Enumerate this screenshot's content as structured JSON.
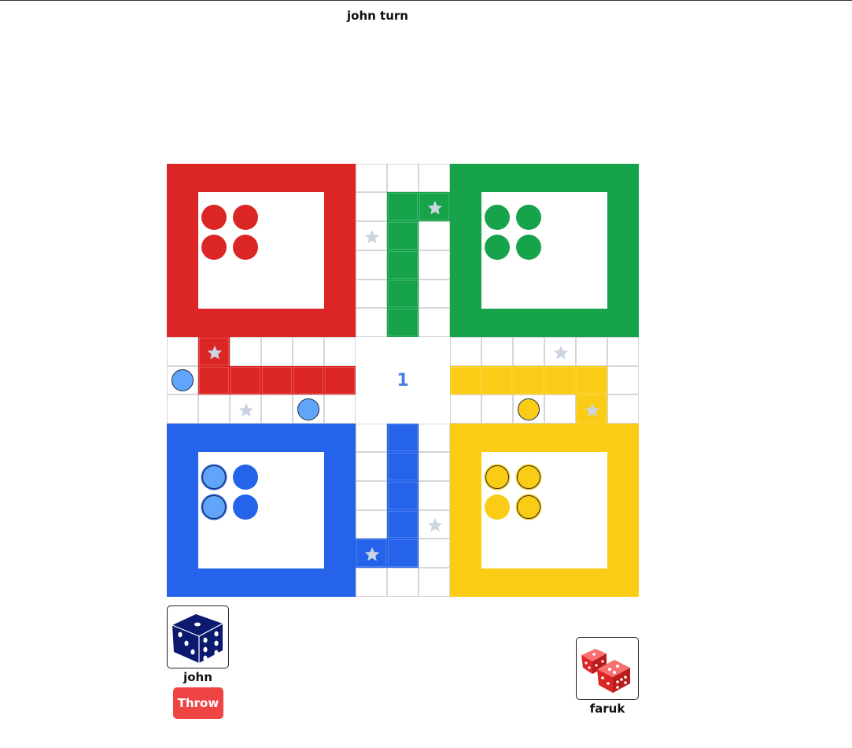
{
  "turn_text": "john turn",
  "center_number": "1",
  "colors": {
    "red": "#dc2626",
    "green": "#16a34a",
    "blue": "#2563eb",
    "yellow": "#facc15",
    "active_token_blue": "#60a5fa",
    "star": "#cbd5e1",
    "grid_line": "#d6d6d6",
    "throw_button": "#ef4444"
  },
  "players": [
    {
      "name": "john",
      "dice_color": "#0b1a6e",
      "icon": "single-dice-icon",
      "active": true
    },
    {
      "name": "faruk",
      "dice_color": "#dc2626",
      "icon": "double-dice-icon",
      "active": false
    }
  ],
  "throw_label": "Throw",
  "tokens_on_track": [
    {
      "color": "blue",
      "row": 7,
      "col": 0
    },
    {
      "color": "blue",
      "row": 8,
      "col": 4
    },
    {
      "color": "yellow",
      "row": 8,
      "col": 11
    }
  ],
  "yard_state": {
    "red": [
      "home",
      "home",
      "home",
      "home"
    ],
    "green": [
      "home",
      "home",
      "home",
      "home"
    ],
    "blue": [
      "token",
      "home",
      "token",
      "home"
    ],
    "yellow": [
      "token",
      "token",
      "home",
      "token"
    ]
  }
}
